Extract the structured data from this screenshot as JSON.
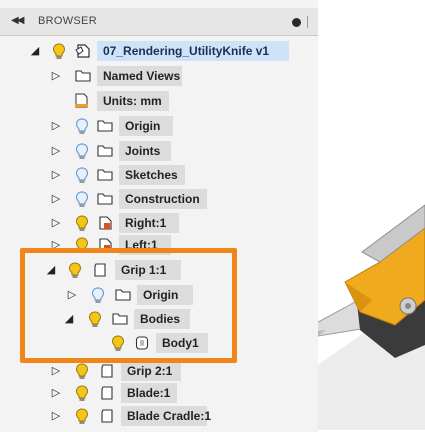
{
  "browser": {
    "title": "BROWSER",
    "collapse_icon": "double-left-arrow-icon"
  },
  "colors": {
    "highlight": "#f0861a",
    "bulb_on": "#f5c518",
    "bulb_off": "#a8c8ec",
    "selected": "#cfe3f8"
  },
  "tree": {
    "root": "07_Rendering_UtilityKnife v1",
    "named_views": "Named Views",
    "units": "Units: mm",
    "origin": "Origin",
    "joints": "Joints",
    "sketches": "Sketches",
    "construction": "Construction",
    "right": "Right:1",
    "left": "Left:1",
    "grip1": "Grip 1:1",
    "grip1_origin": "Origin",
    "grip1_bodies": "Bodies",
    "body1": "Body1",
    "grip2": "Grip 2:1",
    "blade": "Blade:1",
    "blade_cradle": "Blade Cradle:1"
  }
}
